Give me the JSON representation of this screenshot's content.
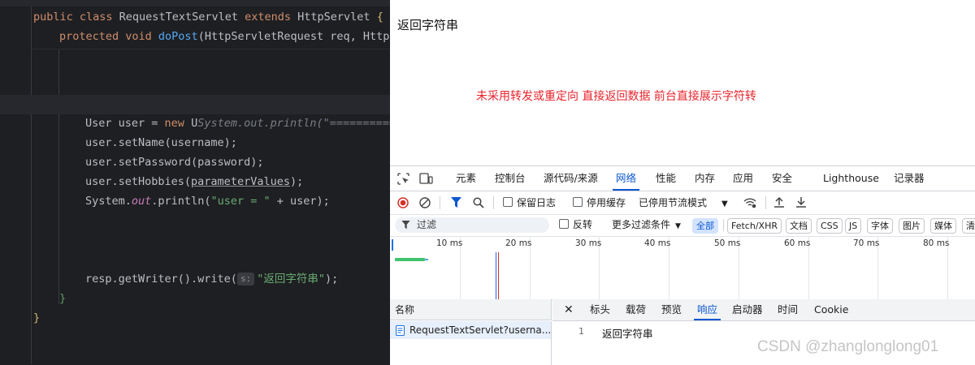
{
  "ide": {
    "lines": {
      "l1": {
        "kw1": "public class ",
        "cls": "RequestTextServlet ",
        "kw2": "extends ",
        "base": "HttpServlet ",
        "brace": "{"
      },
      "l2": {
        "kw": "protected void ",
        "fn": "doPost",
        "rest": "(HttpServletRequest req, HttpS"
      },
      "l3": {
        "a": "User user = ",
        "kw": "new ",
        "b": "U",
        "hint": "System.out.println(\"==========="
      },
      "l4": "user.setName(username);",
      "l5": "user.setPassword(password);",
      "l6": {
        "a": "user.setHobbies(",
        "u": "parameterValues",
        "b": ");"
      },
      "l7": {
        "a": "System.",
        "out": "out",
        "b": ".println(",
        "str": "\"user = \"",
        "c": " + user);"
      },
      "l8": {
        "a": "resp.getWriter().write(",
        "hint": "s:",
        "str": "\"返回字符串\"",
        "b": ");"
      },
      "l9": "}",
      "l10": "}"
    }
  },
  "browser": {
    "page_title": "返回字符串",
    "page_message": "未采用转发或重定向 直接返回数据  前台直接展示字符转"
  },
  "devtools": {
    "tabs": [
      "元素",
      "控制台",
      "源代码/来源",
      "网络",
      "性能",
      "内存",
      "应用",
      "安全",
      "Lighthouse",
      "记录器"
    ],
    "active_tab": "网络",
    "toolbar": {
      "preserve_log": "保留日志",
      "disable_cache": "停用缓存",
      "throttle": "已停用节流模式"
    },
    "filter": {
      "placeholder": "过滤",
      "invert": "反转",
      "more_filters": "更多过滤条件",
      "chips": [
        "全部",
        "Fetch/XHR",
        "文档",
        "CSS",
        "JS",
        "字体",
        "图片",
        "媒体",
        "清"
      ],
      "active_chip": "全部"
    },
    "timeline": {
      "ticks": [
        "10 ms",
        "20 ms",
        "30 ms",
        "40 ms",
        "50 ms",
        "60 ms",
        "70 ms",
        "80 ms"
      ]
    },
    "requests": {
      "header": "名称",
      "rows": [
        "RequestTextServlet?userna..."
      ]
    },
    "detail": {
      "tabs": [
        "标头",
        "载荷",
        "预览",
        "响应",
        "启动器",
        "时间",
        "Cookie"
      ],
      "active_tab": "响应",
      "line_number": "1",
      "response_body": "返回字符串"
    }
  },
  "watermark": "CSDN @zhanglonglong01",
  "colors": {
    "accent": "#0b57d0",
    "record_red": "#d93025",
    "message_red": "#e8242c",
    "ide_bg": "#1e1f22"
  }
}
